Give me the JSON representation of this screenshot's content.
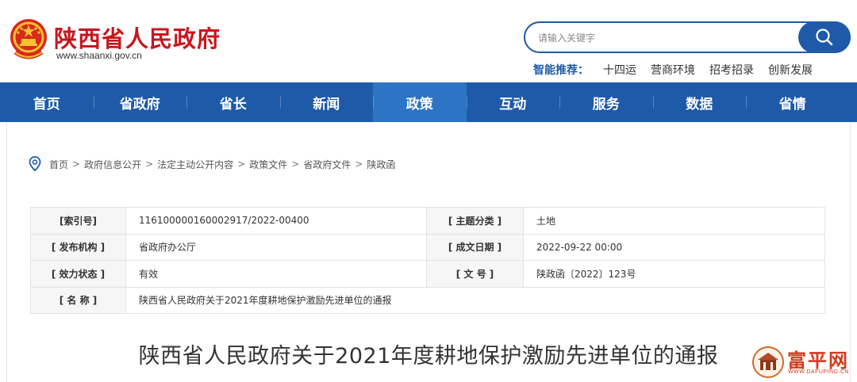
{
  "header": {
    "site_name": "陕西省人民政府",
    "site_url": "www.shaanxi.gov.cn",
    "search_placeholder": "请输入关键字",
    "smart_rec_label": "智能推荐：",
    "rec_links": [
      "十四运",
      "营商环境",
      "招考招录",
      "创新发展"
    ]
  },
  "nav": {
    "items": [
      "首页",
      "省政府",
      "省长",
      "新闻",
      "政策",
      "互动",
      "服务",
      "数据",
      "省情"
    ],
    "active": "政策"
  },
  "breadcrumb": [
    "首页",
    "政府信息公开",
    "法定主动公开内容",
    "政策文件",
    "省政府文件",
    "陕政函"
  ],
  "meta": {
    "rows": [
      {
        "l1": "[索引号]",
        "v1": "11610000016000291​7/2022-00400",
        "l2": "[ 主题分类 ]",
        "v2": "土地"
      },
      {
        "l1": "[ 发布机构 ]",
        "v1": "省政府办公厅",
        "l2": "[ 成文日期 ]",
        "v2": "2022-09-22 00:00"
      },
      {
        "l1": "[ 效力状态 ]",
        "v1": "有效",
        "l2": "[ 文 号 ]",
        "v2": "陕政函〔2022〕123号"
      }
    ],
    "name_label": "[ 名 称 ]",
    "name_value": "陕西省人民政府关于2021年度耕地保护激励先进单位的通报"
  },
  "doc_title": "陕西省人民政府关于2021年度耕地保护激励先进单位的通报",
  "watermark": {
    "text": "富平网",
    "url": "WWW.DAFUPING.CN"
  },
  "colors": {
    "brand_red": "#c8161d",
    "nav_blue": "#1e5aa8",
    "nav_active": "#2d74c4"
  }
}
